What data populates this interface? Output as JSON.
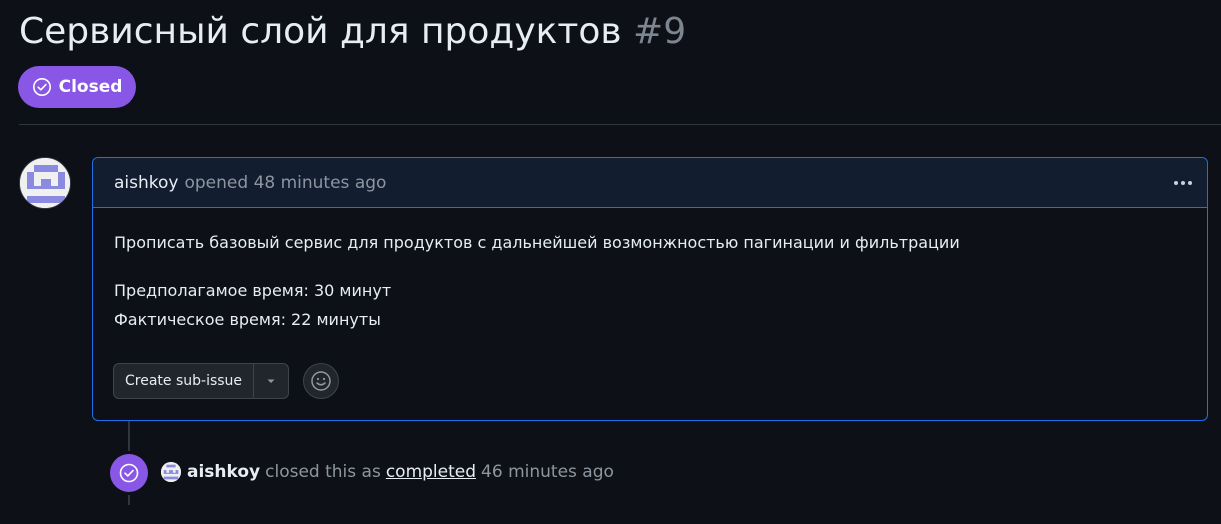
{
  "issue": {
    "title": "Сервисный слой для продуктов",
    "number": "#9",
    "state_label": "Closed",
    "state_icon": "check-circle-icon",
    "state_color": "#8957e5"
  },
  "comment": {
    "author": "aishkoy",
    "meta": "opened 48 minutes ago",
    "menu_icon": "kebab-horizontal-icon",
    "body": {
      "paragraph_1": "Прописать базовый сервис для продуктов с дальнейшей возмонжностью пагинации и фильтрации",
      "line_2": "Предполагамое время: 30 минут",
      "line_3": "Фактическое время: 22 минуты"
    },
    "actions": {
      "create_subissue_label": "Create sub-issue",
      "dropdown_icon": "triangle-down-icon",
      "reaction_icon": "smiley-icon"
    }
  },
  "timeline_event": {
    "icon": "check-circle-icon",
    "author": "aishkoy",
    "action_text": "closed this as",
    "link_text": "completed",
    "time": "46 minutes ago"
  },
  "colors": {
    "background": "#0d1117",
    "accent_blue": "#1f6feb",
    "closed_purple": "#8957e5",
    "muted_text": "#8d96a0"
  }
}
